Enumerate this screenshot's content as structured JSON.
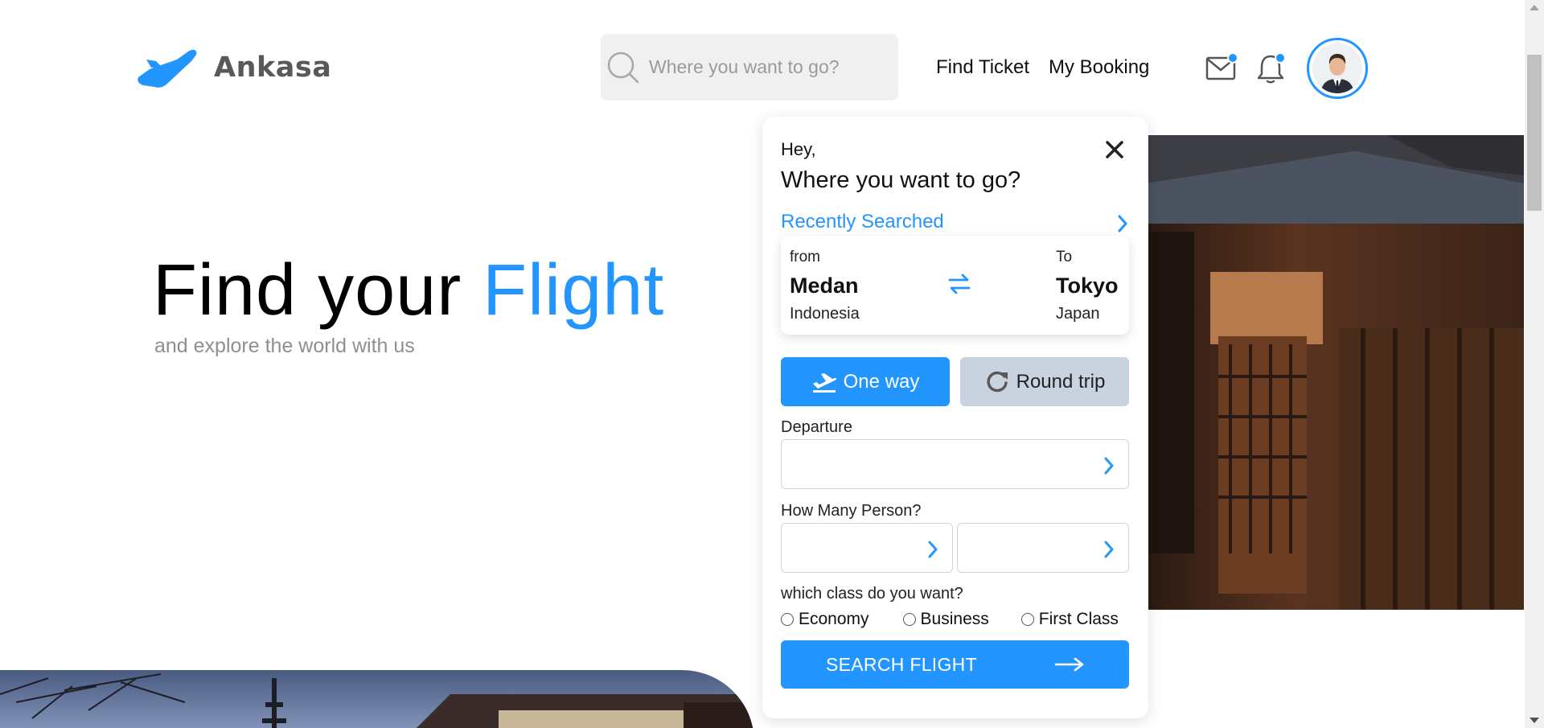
{
  "header": {
    "brand": "Ankasa",
    "search_placeholder": "Where you want to go?",
    "nav": [
      {
        "label": "Find Ticket"
      },
      {
        "label": "My Booking"
      }
    ],
    "icons": [
      "mail-icon",
      "bell-icon"
    ],
    "notification_dot_color": "#2395ff"
  },
  "hero": {
    "title_prefix": "Find your ",
    "title_accent": "Flight",
    "subtitle": "and explore the world with us"
  },
  "card": {
    "greeting": "Hey,",
    "question": "Where you want to go?",
    "recent_label": "Recently Searched",
    "route": {
      "from_label": "from",
      "from_city": "Medan",
      "from_country": "Indonesia",
      "to_label": "To",
      "to_city": "Tokyo",
      "to_country": "Japan"
    },
    "trip_types": {
      "one_way": "One way",
      "round_trip": "Round trip",
      "selected": "one_way"
    },
    "departure_label": "Departure",
    "departure_value": "",
    "persons_label": "How Many Person?",
    "class_label": "which class do you want?",
    "classes": [
      "Economy",
      "Business",
      "First Class"
    ],
    "search_button": "SEARCH FLIGHT"
  },
  "colors": {
    "accent": "#2395ff",
    "muted_button": "#c9d3e0",
    "input_bg": "#f0f0f0"
  }
}
